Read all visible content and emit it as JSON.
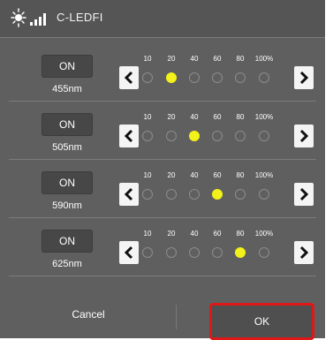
{
  "title": "C-LEDFI",
  "tick_labels": [
    "10",
    "20",
    "40",
    "60",
    "80",
    "100%"
  ],
  "rows": [
    {
      "on_label": "ON",
      "wavelength": "455nm",
      "selected_index": 1
    },
    {
      "on_label": "ON",
      "wavelength": "505nm",
      "selected_index": 2
    },
    {
      "on_label": "ON",
      "wavelength": "590nm",
      "selected_index": 3
    },
    {
      "on_label": "ON",
      "wavelength": "625nm",
      "selected_index": 4
    }
  ],
  "footer": {
    "cancel_label": "Cancel",
    "ok_label": "OK"
  },
  "colors": {
    "selected_dot": "#f2f21a",
    "highlight": "#e01717",
    "background": "#5f5f5f"
  },
  "icons": {
    "title": "led-signal-icon",
    "decrease": "chevron-left-icon",
    "increase": "chevron-right-icon"
  }
}
